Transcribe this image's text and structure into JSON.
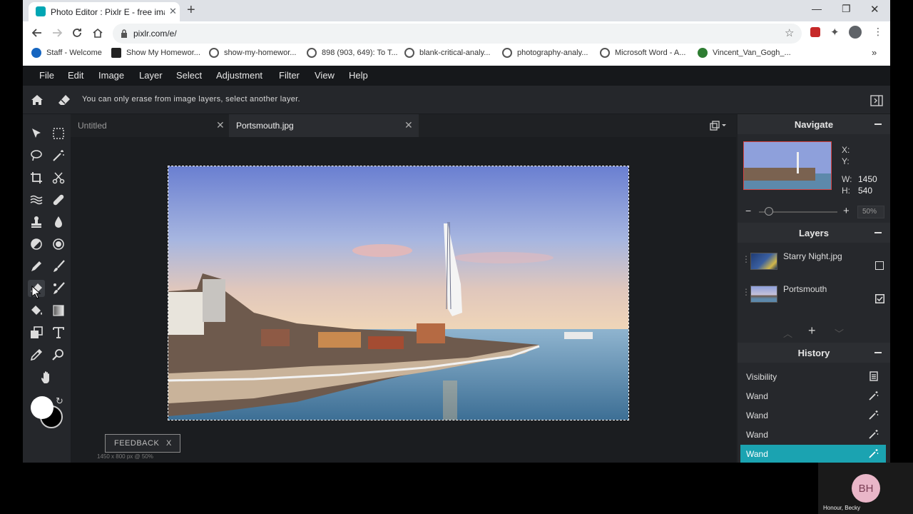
{
  "browser": {
    "tab_title": "Photo Editor : Pixlr E - free image editor",
    "url": "pixlr.com/e/",
    "bookmarks": [
      {
        "label": "Staff - Welcome",
        "color": "#1565c0"
      },
      {
        "label": "Show My Homewor...",
        "color": "#222222"
      },
      {
        "label": "show-my-homewor...",
        "color": "#555555"
      },
      {
        "label": "898 (903, 649): To T...",
        "color": "#555555"
      },
      {
        "label": "blank-critical-analy...",
        "color": "#555555"
      },
      {
        "label": "photography-analy...",
        "color": "#555555"
      },
      {
        "label": "Microsoft Word - A...",
        "color": "#555555"
      },
      {
        "label": "Vincent_Van_Gogh_...",
        "color": "#2e7d32"
      }
    ],
    "more": "»"
  },
  "menu": [
    "File",
    "Edit",
    "Image",
    "Layer",
    "Select",
    "Adjustment",
    "Filter",
    "View",
    "Help"
  ],
  "options": {
    "hint": "You can only erase from image layers, select another layer."
  },
  "doc_tabs": [
    {
      "title": "Untitled",
      "active": false
    },
    {
      "title": "Portsmouth.jpg",
      "active": true
    }
  ],
  "feedback": {
    "label": "FEEDBACK",
    "close": "X"
  },
  "doc_info": "1450 x 800 px @ 50%",
  "navigate": {
    "title": "Navigate",
    "x_label": "X:",
    "y_label": "Y:",
    "w_label": "W:",
    "w_value": "1450",
    "h_label": "H:",
    "h_value": "540",
    "zoom": "50%",
    "zoom_fraction": 0.13
  },
  "layers": {
    "title": "Layers",
    "items": [
      {
        "name": "Starry Night.jpg",
        "visible": false
      },
      {
        "name": "Portsmouth",
        "visible": true
      }
    ]
  },
  "history": {
    "title": "History",
    "items": [
      {
        "label": "Visibility",
        "active": false,
        "icon": "document-icon"
      },
      {
        "label": "Wand",
        "active": false,
        "icon": "magic-wand-icon"
      },
      {
        "label": "Wand",
        "active": false,
        "icon": "magic-wand-icon"
      },
      {
        "label": "Wand",
        "active": false,
        "icon": "magic-wand-icon"
      },
      {
        "label": "Wand",
        "active": true,
        "icon": "magic-wand-icon"
      }
    ]
  },
  "colors": {
    "accent": "#1ba3b1",
    "primary_color": "#ffffff",
    "secondary_color": "#000000"
  },
  "user": {
    "initials": "BH",
    "name": "Honour, Becky"
  }
}
